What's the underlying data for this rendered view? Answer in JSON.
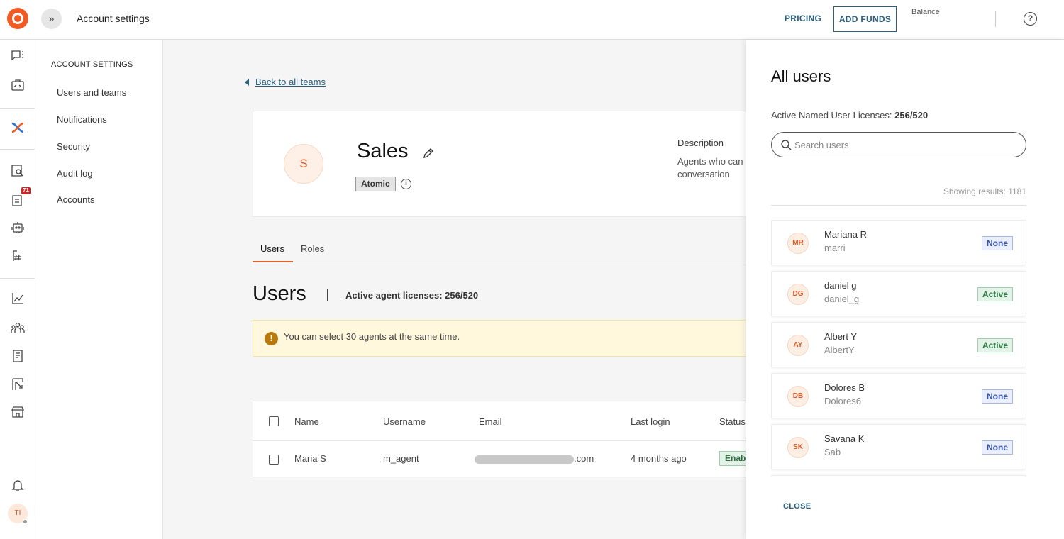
{
  "header": {
    "title": "Account settings",
    "pricing_label": "PRICING",
    "add_funds_label": "ADD FUNDS",
    "balance_label": "Balance"
  },
  "rail": {
    "notification_badge": "71",
    "user_initials": "TI"
  },
  "settings_sidebar": {
    "heading": "ACCOUNT SETTINGS",
    "items": [
      {
        "label": "Users and teams"
      },
      {
        "label": "Notifications"
      },
      {
        "label": "Security"
      },
      {
        "label": "Audit log"
      },
      {
        "label": "Accounts"
      }
    ]
  },
  "main": {
    "back_link": "Back to all teams",
    "team": {
      "initial": "S",
      "name": "Sales",
      "type_badge": "Atomic",
      "description_label": "Description",
      "description_line1": "Agents who can",
      "description_line2": "conversation"
    },
    "tabs": [
      {
        "label": "Users"
      },
      {
        "label": "Roles"
      }
    ],
    "users_title": "Users",
    "agent_licenses": "Active agent licenses: 256/520",
    "notice": "You can select 30 agents at the same time.",
    "table": {
      "headers": [
        "Name",
        "Username",
        "Email",
        "Last login",
        "Status"
      ],
      "rows": [
        {
          "name": "Maria S",
          "username": "m_agent",
          "email_suffix": ".com",
          "last_login": "4 months ago",
          "status": "Enab"
        }
      ]
    }
  },
  "drawer": {
    "title": "All users",
    "licenses_label": "Active Named User Licenses: ",
    "licenses_value": "256/520",
    "search_placeholder": "Search users",
    "results_text": "Showing results: 1181",
    "users": [
      {
        "initials": "MR",
        "name": "Mariana R",
        "username": "marri",
        "status": "None"
      },
      {
        "initials": "DG",
        "name": "daniel g",
        "username": "daniel_g",
        "status": "Active"
      },
      {
        "initials": "AY",
        "name": "Albert Y",
        "username": "AlbertY",
        "status": "Active"
      },
      {
        "initials": "DB",
        "name": "Dolores B",
        "username": "Dolores6",
        "status": "None"
      },
      {
        "initials": "SK",
        "name": "Savana K",
        "username": "Sab",
        "status": "None"
      }
    ],
    "close_label": "CLOSE"
  },
  "colors": {
    "brand": "#f15a22",
    "link": "#2a5f7e",
    "active_tab": "#e0632e",
    "badge_active": "#2b7a45",
    "badge_none": "#3a55a8"
  }
}
